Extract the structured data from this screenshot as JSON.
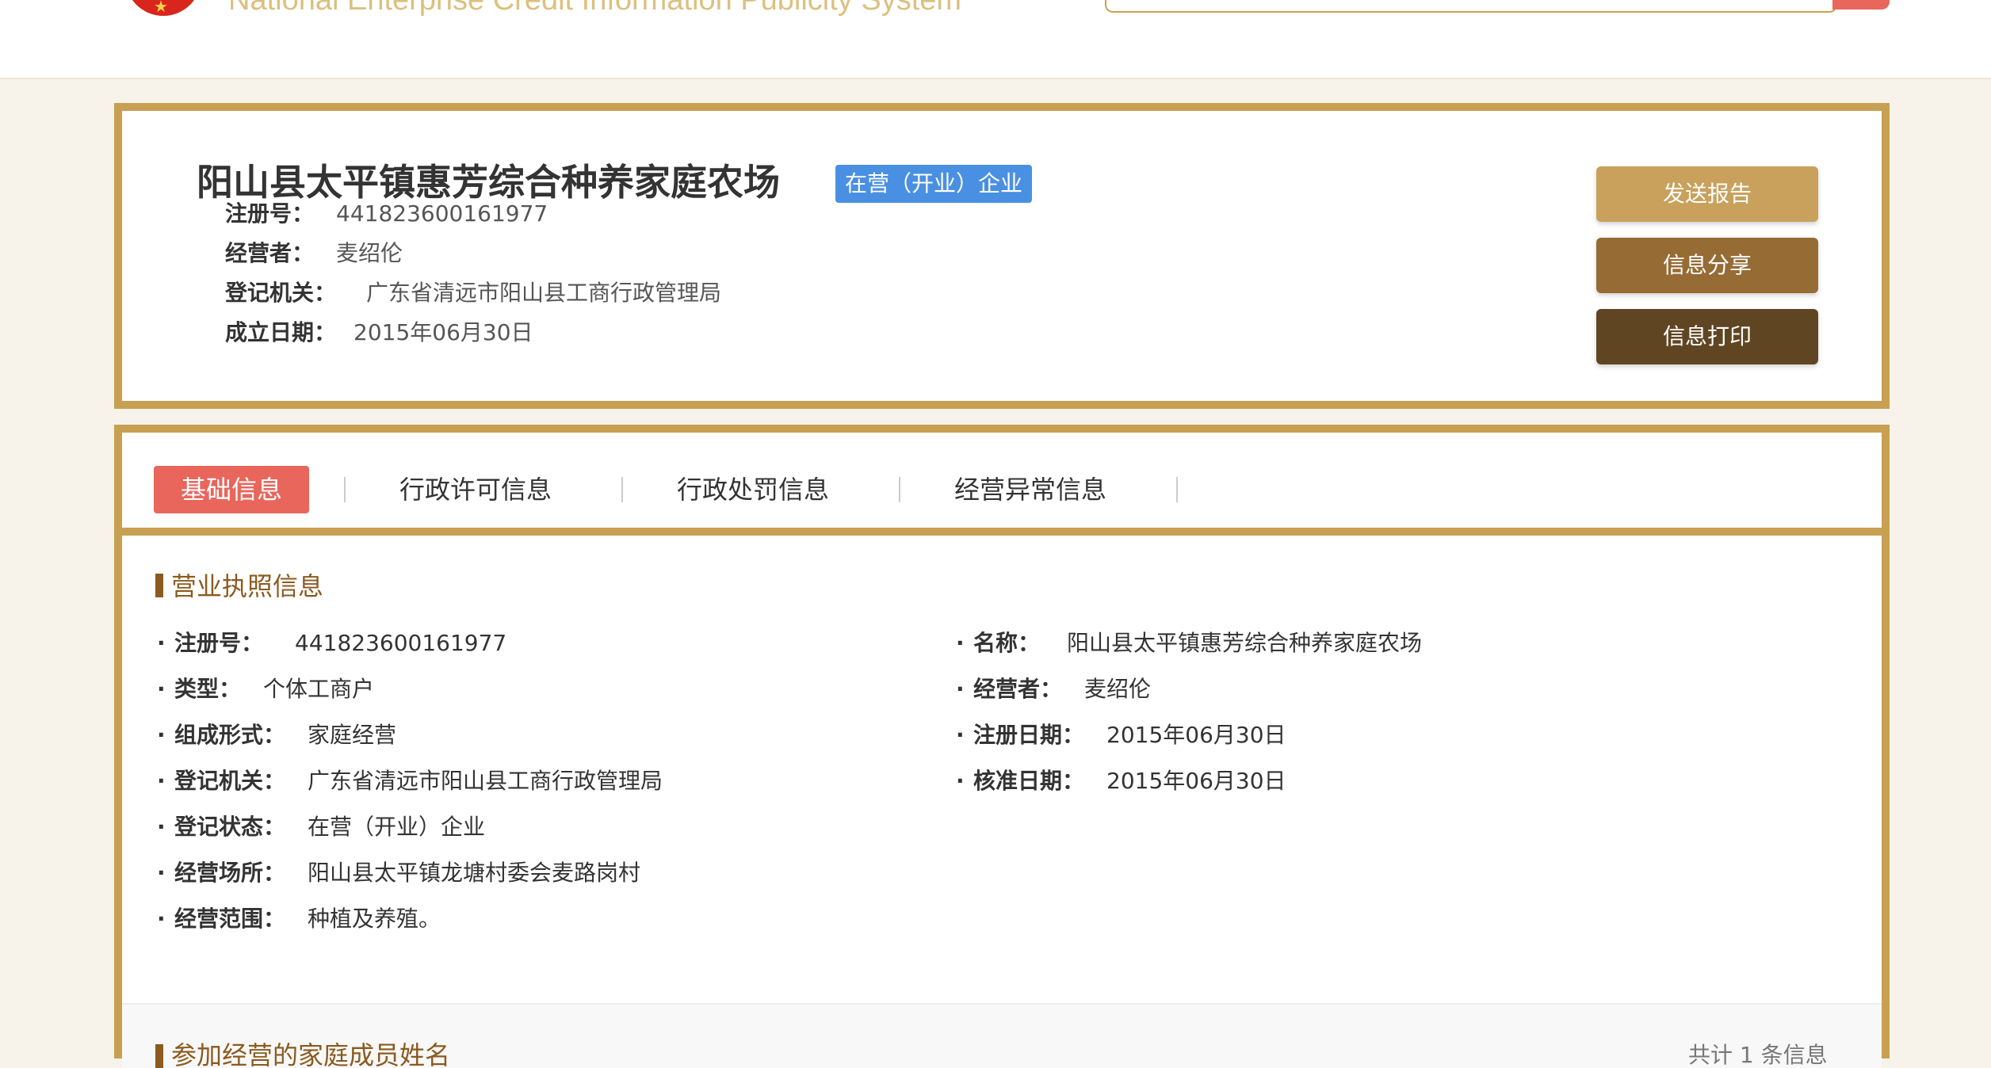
{
  "header": {
    "site_title_en": "National Enterprise Credit Information Publicity System"
  },
  "company": {
    "name": "阳山县太平镇惠芳综合种养家庭农场",
    "status_tag": "在营（开业）企业",
    "meta": [
      {
        "label": "注册号：",
        "value": "441823600161977"
      },
      {
        "label": "经营者：",
        "value": "麦绍伦"
      },
      {
        "label": "登记机关：",
        "value": "广东省清远市阳山县工商行政管理局"
      },
      {
        "label": "成立日期：",
        "value": "2015年06月30日"
      }
    ],
    "actions": {
      "send_report": "发送报告",
      "share_info": "信息分享",
      "print_info": "信息打印"
    }
  },
  "tabs": [
    {
      "label": "基础信息",
      "active": true
    },
    {
      "label": "行政许可信息",
      "active": false
    },
    {
      "label": "行政处罚信息",
      "active": false
    },
    {
      "label": "经营异常信息",
      "active": false
    }
  ],
  "license_section": {
    "title": "营业执照信息",
    "bullet": "·",
    "left_fields": [
      {
        "label": "注册号：",
        "value": "441823600161977"
      },
      {
        "label": "类型：",
        "value": "个体工商户"
      },
      {
        "label": "组成形式：",
        "value": "家庭经营"
      },
      {
        "label": "登记机关：",
        "value": "广东省清远市阳山县工商行政管理局"
      },
      {
        "label": "登记状态：",
        "value": "在营（开业）企业"
      },
      {
        "label": "经营场所：",
        "value": "阳山县太平镇龙塘村委会麦路岗村"
      },
      {
        "label": "经营范围：",
        "value": "种植及养殖。"
      }
    ],
    "right_fields": [
      {
        "label": "名称：",
        "value": "阳山县太平镇惠芳综合种养家庭农场"
      },
      {
        "label": "经营者：",
        "value": "麦绍伦"
      },
      {
        "label": "注册日期：",
        "value": "2015年06月30日"
      },
      {
        "label": "核准日期：",
        "value": "2015年06月30日"
      }
    ]
  },
  "next_section": {
    "title": "参加经营的家庭成员姓名",
    "count_text": "共计 1 条信息"
  },
  "colors": {
    "gold_border": "#c8a052",
    "tab_active": "#e8665c",
    "status_tag": "#4a90e2",
    "section_title": "#8b5a1f",
    "btn_send": "#c9a15c",
    "btn_share": "#966b34",
    "btn_print": "#604522"
  }
}
